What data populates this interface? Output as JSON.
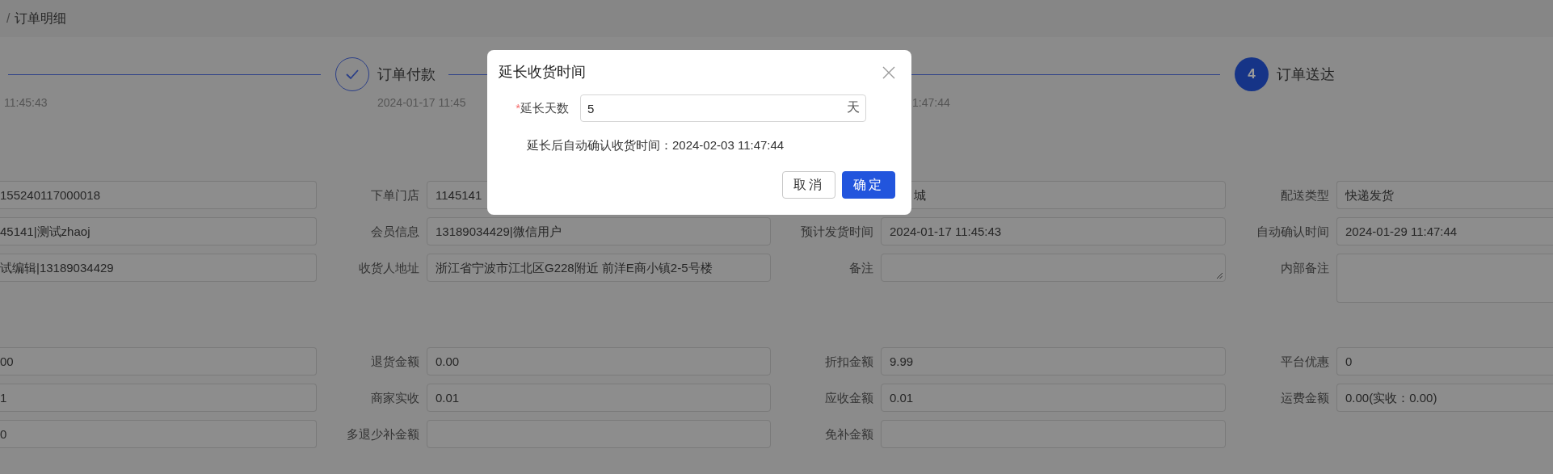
{
  "breadcrumb": {
    "separator": "/",
    "current": "订单明细"
  },
  "steps": [
    {
      "time": "11:45:43"
    },
    {
      "kind": "finished",
      "label": "订单付款",
      "time": "2024-01-17 11:45"
    },
    {
      "time": "1:47:44"
    },
    {
      "kind": "process",
      "number": "4",
      "label": "订单送达"
    }
  ],
  "sections": [
    {
      "rows": [
        [
          {
            "kind": "input",
            "value": "155240117000018"
          },
          {
            "kind": "input",
            "label": "下单门店",
            "value": "1145141"
          },
          {
            "kind": "input",
            "value": "城"
          },
          {
            "kind": "input",
            "label": "配送类型",
            "value": "快递发货"
          }
        ],
        [
          {
            "kind": "input",
            "value": "45141|测试zhaoj"
          },
          {
            "kind": "input",
            "label": "会员信息",
            "value": "13189034429|微信用户"
          },
          {
            "kind": "input",
            "label": "预计发货时间",
            "value": "2024-01-17 11:45:43"
          },
          {
            "kind": "input",
            "label": "自动确认时间",
            "value": "2024-01-29 11:47:44"
          }
        ],
        [
          {
            "kind": "input",
            "value": "试编辑|13189034429"
          },
          {
            "kind": "input",
            "label": "收货人地址",
            "value": "浙江省宁波市江北区G228附近 前洋E商小镇2-5号楼"
          },
          {
            "kind": "textarea",
            "label": "备注"
          },
          {
            "kind": "tall-textarea",
            "label": "内部备注"
          }
        ]
      ]
    },
    {
      "rows": [
        [
          {
            "kind": "input",
            "value": "00"
          },
          {
            "kind": "input",
            "label": "退货金额",
            "value": "0.00"
          },
          {
            "kind": "input",
            "label": "折扣金额",
            "value": "9.99"
          },
          {
            "kind": "input",
            "label": "平台优惠",
            "value": "0"
          }
        ],
        [
          {
            "kind": "input",
            "value": "1"
          },
          {
            "kind": "input",
            "label": "商家实收",
            "value": "0.01"
          },
          {
            "kind": "input",
            "label": "应收金额",
            "value": "0.01"
          },
          {
            "kind": "input",
            "label": "运费金额",
            "value": "0.00(实收：0.00)"
          }
        ],
        [
          {
            "kind": "input",
            "value": "0"
          },
          {
            "kind": "input",
            "label": "多退少补金额"
          },
          {
            "kind": "input",
            "label": "免补金额"
          }
        ]
      ]
    }
  ],
  "dialog": {
    "title": "延长收货时间",
    "field": {
      "required_mark": "*",
      "label": "延长天数",
      "value": "5",
      "suffix": "天"
    },
    "hint": "延长后自动确认收货时间：2024-02-03 11:47:44",
    "buttons": [
      {
        "label": "取消",
        "kind": "default"
      },
      {
        "label": "确定",
        "kind": "primary"
      }
    ]
  }
}
